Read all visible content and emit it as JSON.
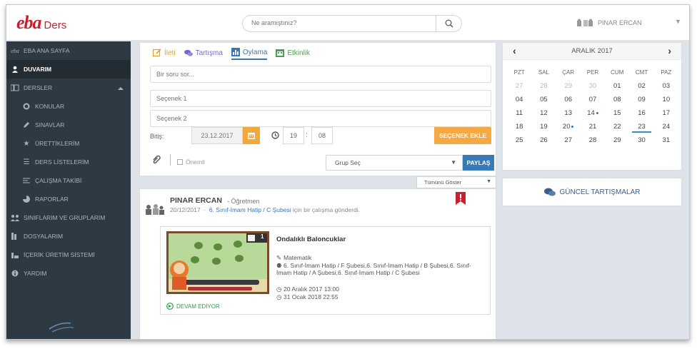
{
  "header": {
    "logo_mark": "eba",
    "logo_text": "Ders",
    "search_placeholder": "Ne aramıştınız?",
    "user_name": "PINAR ERCAN"
  },
  "sidebar": {
    "items": [
      {
        "label": "EBA ANA SAYFA",
        "icon": "eba-icon"
      },
      {
        "label": "DUVARIM",
        "icon": "user-icon",
        "active": true
      },
      {
        "label": "DERSLER",
        "icon": "courses-icon"
      },
      {
        "label": "KONULAR",
        "icon": "topics-icon"
      },
      {
        "label": "SINAVLAR",
        "icon": "pencil-icon"
      },
      {
        "label": "ÜRETTİKLERİM",
        "icon": "star-icon"
      },
      {
        "label": "DERS LİSTELERİM",
        "icon": "list-icon"
      },
      {
        "label": "ÇALIŞMA TAKİBİ",
        "icon": "tracking-icon"
      },
      {
        "label": "RAPORLAR",
        "icon": "pie-icon"
      },
      {
        "label": "SINIFLARIM VE GRUPLARIM",
        "icon": "group-icon"
      },
      {
        "label": "DOSYALARIM",
        "icon": "files-icon"
      },
      {
        "label": "İÇERİK ÜRETİM SİSTEMİ",
        "icon": "bar-icon"
      },
      {
        "label": "YARDIM",
        "icon": "info-icon"
      }
    ]
  },
  "composer": {
    "tabs": [
      {
        "label": "İleti",
        "icon": "edit-icon",
        "color": "#e0a12c"
      },
      {
        "label": "Tartışma",
        "icon": "chat-icon",
        "color": "#7a63c8"
      },
      {
        "label": "Oylama",
        "icon": "poll-icon",
        "color": "#3a76b5"
      },
      {
        "label": "Etkinlik",
        "icon": "calendar-icon",
        "color": "#4aa14b"
      }
    ],
    "question_placeholder": "Bir soru sor...",
    "option1_placeholder": "Seçenek 1",
    "option2_placeholder": "Seçenek 2",
    "end_label": "Bitiş:",
    "end_date": "23.12.2017",
    "hour": "19",
    "minute": "08",
    "add_option_label": "SEÇENEK EKLE",
    "important_label": "Önemli",
    "group_select": "Grup Seç",
    "share_label": "PAYLAŞ"
  },
  "filter": {
    "label": "Tümünü Göster"
  },
  "post": {
    "author": "PINAR ERCAN",
    "role": "- Öğretmen",
    "date": "20/12/2017",
    "class_link": "6. Sınıf-İmam Hatip / C Şubesi",
    "action": "için bir çalışma gönderdi.",
    "card": {
      "thumb_badge": "1",
      "title": "Ondalıklı Baloncuklar",
      "subject": "Matematik",
      "classes": "6. Sınıf-İmam Hatip / F Şubesi,6. Sınıf-İmam Hatip / B Şubesi,6. Sınıf-İmam Hatip / A Şubesi,6. Sınıf-İmam Hatip / C Şubesi",
      "start": "20 Aralık 2017 13:00",
      "end": "31 Ocak 2018 22:55",
      "status": "DEVAM EDİYOR"
    }
  },
  "calendar": {
    "month_label": "ARALIK 2017",
    "weekdays": [
      "PZT",
      "SAL",
      "ÇAR",
      "PER",
      "CUM",
      "CMT",
      "PAZ"
    ],
    "weeks": [
      [
        {
          "d": "27",
          "m": true
        },
        {
          "d": "28",
          "m": true
        },
        {
          "d": "29",
          "m": true
        },
        {
          "d": "30",
          "m": true
        },
        {
          "d": "01"
        },
        {
          "d": "02"
        },
        {
          "d": "03"
        }
      ],
      [
        {
          "d": "04"
        },
        {
          "d": "05"
        },
        {
          "d": "06"
        },
        {
          "d": "07"
        },
        {
          "d": "08"
        },
        {
          "d": "09"
        },
        {
          "d": "10"
        }
      ],
      [
        {
          "d": "11"
        },
        {
          "d": "12"
        },
        {
          "d": "13"
        },
        {
          "d": "14",
          "dot": true
        },
        {
          "d": "15"
        },
        {
          "d": "16"
        },
        {
          "d": "17"
        }
      ],
      [
        {
          "d": "18"
        },
        {
          "d": "19"
        },
        {
          "d": "20",
          "dot": true
        },
        {
          "d": "21"
        },
        {
          "d": "22"
        },
        {
          "d": "23",
          "today": true
        },
        {
          "d": "24"
        }
      ],
      [
        {
          "d": "25"
        },
        {
          "d": "26"
        },
        {
          "d": "27"
        },
        {
          "d": "28"
        },
        {
          "d": "29"
        },
        {
          "d": "30"
        },
        {
          "d": "31"
        }
      ]
    ]
  },
  "forum": {
    "label": "GÜNCEL TARTIŞMALAR"
  },
  "colors": {
    "brand": "#c8202e",
    "sidebar": "#2e3a43",
    "accent": "#3a76b5",
    "warn": "#f4a944"
  }
}
